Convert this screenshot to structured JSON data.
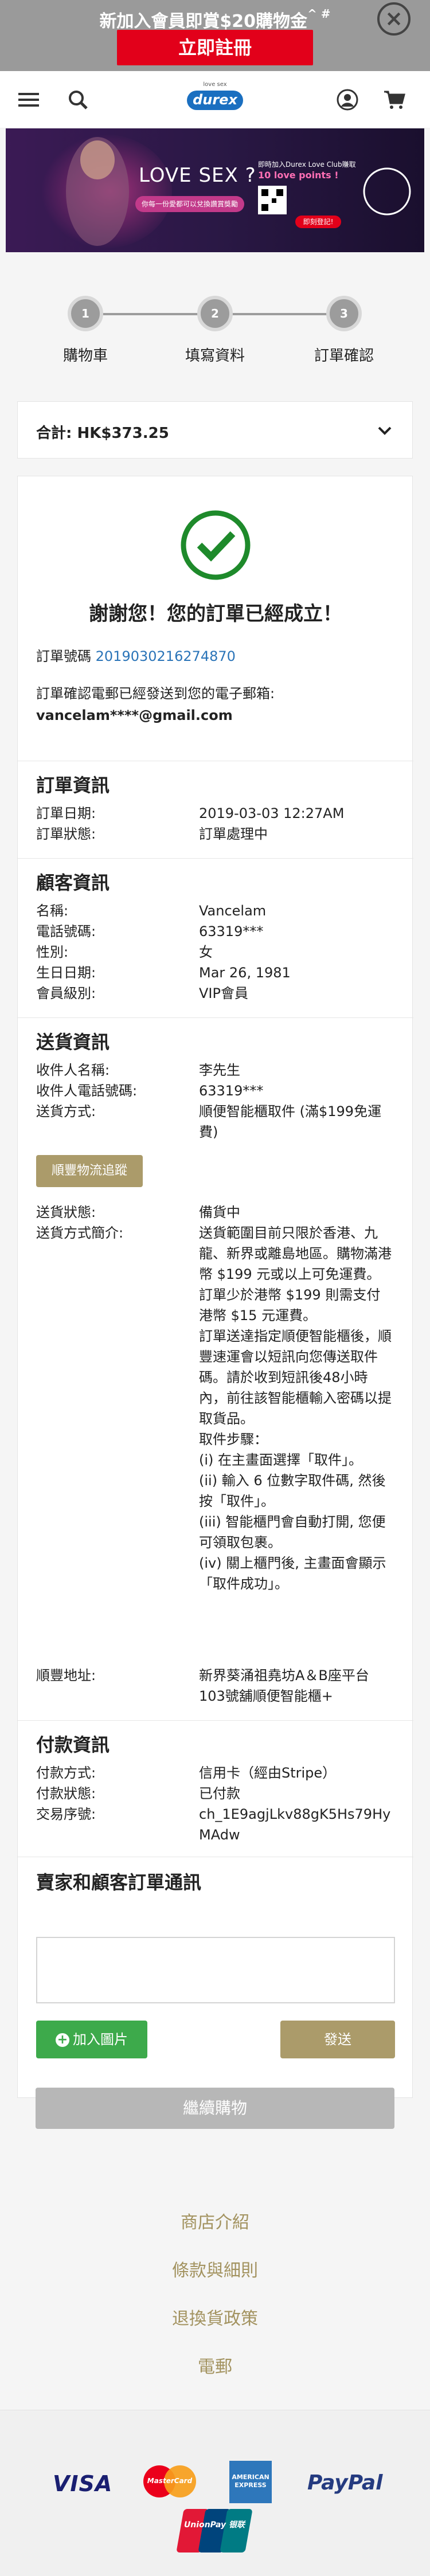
{
  "promo": {
    "text": "新加入會員即賞$20購物金",
    "text_suffix": "^ #",
    "button": "立即註冊"
  },
  "header": {
    "logo_text": "durex",
    "logo_small": "love sex"
  },
  "banner": {
    "headline": "LOVE SEX ?",
    "line1": "即時加入Durex Love Club賺取",
    "line2": "10 love points !",
    "cta": "即刻登記!",
    "sub": "你每一份愛都可以兌換讚賞獎勵"
  },
  "progress": {
    "steps": [
      {
        "num": "1",
        "label": "購物車"
      },
      {
        "num": "2",
        "label": "填寫資料"
      },
      {
        "num": "3",
        "label": "訂單確認"
      }
    ]
  },
  "total": {
    "label": "合計: HK$373.25"
  },
  "confirm": {
    "thanks": "謝謝您！您的訂單已經成立！",
    "order_no_label": "訂單號碼",
    "order_no": "2019030216274870",
    "email_note": "訂單確認電郵已經發送到您的電子郵箱:",
    "email": "vancelam****@gmail.com"
  },
  "order_info": {
    "title": "訂單資訊",
    "rows": [
      {
        "label": "訂單日期:",
        "value": "2019-03-03 12:27AM"
      },
      {
        "label": "訂單狀態:",
        "value": "訂單處理中"
      }
    ]
  },
  "customer_info": {
    "title": "顧客資訊",
    "rows": [
      {
        "label": "名稱:",
        "value": "Vancelam"
      },
      {
        "label": "電話號碼:",
        "value": "63319***"
      },
      {
        "label": "性別:",
        "value": "女"
      },
      {
        "label": "生日日期:",
        "value": "Mar 26, 1981"
      },
      {
        "label": "會員級別:",
        "value": "VIP會員"
      }
    ]
  },
  "delivery_info": {
    "title": "送貨資訊",
    "recipient_label": "收件人名稱:",
    "recipient": "李先生",
    "phone_label": "收件人電話號碼:",
    "phone": "63319***",
    "method_label": "送貨方式:",
    "method": "順便智能櫃取件 (滿$199免運費)",
    "track_button": "順豐物流追蹤",
    "status_label": "送貨狀態:",
    "status": "備貨中",
    "desc_label": "送貨方式簡介:",
    "desc1": "送貨範圍目前只限於香港、九龍、新界或離島地區。購物滿港幣 $199 元或以上可免運費。訂單少於港幣 $199 則需支付港幣 $15 元運費。",
    "desc2": "訂單送達指定順便智能櫃後，順豐速運會以短訊向您傳送取件碼。請於收到短訊後48小時內，前往該智能櫃輸入密碼以提取貨品。",
    "steps_title": "取件步驟：",
    "step1": "(i) 在主畫面選擇「取件」。",
    "step2": "(ii) 輸入 6 位數字取件碼, 然後按「取件」。",
    "step3": "(iii) 智能櫃門會自動打開, 您便可領取包裹。",
    "step4": "(iv) 關上櫃門後, 主畫面會顯示「取件成功」。",
    "address_label": "順豐地址:",
    "address": "新界葵涌祖堯坊A＆B座平台103號舖順便智能櫃+"
  },
  "payment_info": {
    "title": "付款資訊",
    "rows": [
      {
        "label": "付款方式:",
        "value": "信用卡（經由Stripe）"
      },
      {
        "label": "付款狀態:",
        "value": "已付款"
      },
      {
        "label": "交易序號:",
        "value": "ch_1E9agjLkv88gK5Hs79HyMAdw"
      }
    ]
  },
  "messages": {
    "title": "賣家和顧客訂單通訊",
    "add_image": "加入圖片",
    "send": "發送"
  },
  "continue_button": "繼續購物",
  "footer": {
    "links": [
      "商店介紹",
      "條款與細則",
      "退換貨政策",
      "電郵"
    ],
    "payments": [
      "VISA",
      "MasterCard",
      "AMERICAN EXPRESS",
      "PayPal",
      "UnionPay 银联"
    ]
  },
  "colors": {
    "accent_gold": "#ab9b6a",
    "link_blue": "#2a74b8",
    "promo_red": "#e2001a",
    "success_green": "#1e8a2b"
  }
}
